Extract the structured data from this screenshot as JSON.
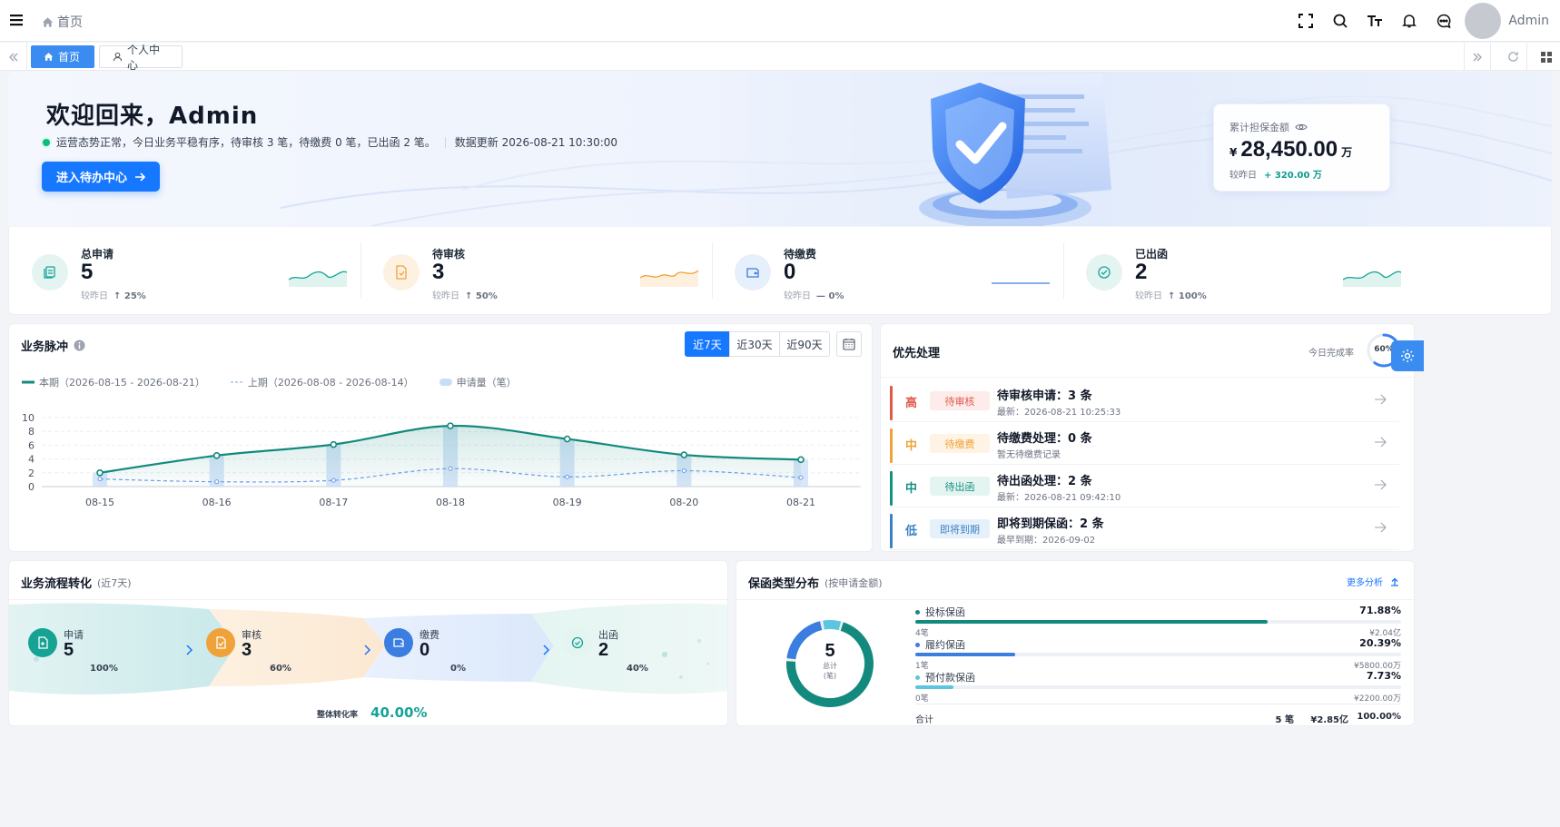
{
  "header": {
    "breadcrumb": "首页",
    "user_name": "Admin"
  },
  "tabs": [
    {
      "label": "首页",
      "active": true
    },
    {
      "label": "个人中心",
      "active": false
    }
  ],
  "hero": {
    "welcome": "欢迎回来，Admin",
    "status_text": "运营态势正常，今日业务平稳有序，待审核 3 笔，待缴费 0 笔，已出函 2 笔。",
    "data_update": "数据更新 2026-08-21 10:30:00",
    "cta_label": "进入待办中心"
  },
  "guarantee": {
    "label": "累计担保金额",
    "currency": "¥",
    "value": "28,450.00",
    "unit": "万",
    "compare_label": "较昨日",
    "compare_value": "+ 320.00 万"
  },
  "stats": [
    {
      "title": "总申请",
      "value": "5",
      "compare_label": "较昨日",
      "change": "↑ 25%",
      "color": "#14a39a"
    },
    {
      "title": "待审核",
      "value": "3",
      "compare_label": "较昨日",
      "change": "↑ 50%",
      "color": "#f0a23a"
    },
    {
      "title": "待缴费",
      "value": "0",
      "compare_label": "较昨日",
      "change": "— 0%",
      "color": "#3b7de0"
    },
    {
      "title": "已出函",
      "value": "2",
      "compare_label": "较昨日",
      "change": "↑ 100%",
      "color": "#14a39a"
    }
  ],
  "pulse": {
    "title": "业务脉冲",
    "ranges": [
      "近7天",
      "近30天",
      "近90天"
    ],
    "active_range": "近7天",
    "legend": {
      "current": "本期（2026-08-15 - 2026-08-21）",
      "previous": "上期（2026-08-08 - 2026-08-14）",
      "volume": "申请量（笔）"
    }
  },
  "chart_data": {
    "type": "line",
    "categories": [
      "08-15",
      "08-16",
      "08-17",
      "08-18",
      "08-19",
      "08-20",
      "08-21"
    ],
    "series": [
      {
        "name": "本期（2026-08-15 - 2026-08-21）",
        "type": "line",
        "values": [
          2,
          4.5,
          6.1,
          8.8,
          6.9,
          4.6,
          3.9
        ],
        "color": "#138a7c"
      },
      {
        "name": "上期（2026-08-08 - 2026-08-14）",
        "type": "line",
        "values": [
          1.1,
          0.7,
          0.9,
          2.6,
          1.4,
          2.3,
          1.3
        ],
        "color": "#6b9ee8",
        "dashed": true
      },
      {
        "name": "申请量（笔）",
        "type": "bar",
        "values": [
          2,
          4.5,
          6.1,
          8.8,
          6.9,
          4.6,
          3.9
        ],
        "color": "#c9def5"
      }
    ],
    "ylim": [
      0,
      10
    ],
    "yticks": [
      0,
      2,
      4,
      6,
      8,
      10
    ],
    "grid": true,
    "legend": "top-left"
  },
  "priority": {
    "title": "优先处理",
    "completion_label": "今日完成率",
    "completion_value": "60%",
    "completion_fraction": 0.6,
    "items": [
      {
        "level": "高",
        "tag": "待审核",
        "title": "待审核申请：3 条",
        "sub": "最新：2026-08-21 10:25:33",
        "color": "#e05a4c",
        "bg": "#fdecea"
      },
      {
        "level": "中",
        "tag": "待缴费",
        "title": "待缴费处理：0 条",
        "sub": "暂无待缴费记录",
        "color": "#f0a23a",
        "bg": "#fef3e4"
      },
      {
        "level": "中",
        "tag": "待出函",
        "title": "待出函处理：2 条",
        "sub": "最新：2026-08-21 09:42:10",
        "color": "#14917f",
        "bg": "#e3f4f1"
      },
      {
        "level": "低",
        "tag": "即将到期",
        "title": "即将到期保函：2 条",
        "sub": "最早到期：2026-09-02",
        "color": "#3b82c4",
        "bg": "#e6f0fa"
      }
    ]
  },
  "flow": {
    "title": "业务流程转化",
    "subtitle": "(近7天)",
    "steps": [
      {
        "label": "申请",
        "value": "5",
        "pct": "100%",
        "color": "#16a394"
      },
      {
        "label": "审核",
        "value": "3",
        "pct": "60%",
        "color": "#f0a23a"
      },
      {
        "label": "缴费",
        "value": "0",
        "pct": "0%",
        "color": "#3b7de0"
      },
      {
        "label": "出函",
        "value": "2",
        "pct": "40%",
        "color": "#16a394"
      }
    ],
    "overall_label": "整体转化率",
    "overall_value": "40.00%"
  },
  "distribution": {
    "title": "保函类型分布",
    "subtitle": "(按申请金额)",
    "more_label": "更多分析",
    "total_value": "5",
    "total_label": "总计",
    "total_unit": "(笔)",
    "items": [
      {
        "name": "投标保函",
        "pct": "71.88%",
        "fraction": 0.7188,
        "count": "4笔",
        "amount": "¥2.04亿",
        "color": "#148a7e"
      },
      {
        "name": "履约保函",
        "pct": "20.39%",
        "fraction": 0.2039,
        "count": "1笔",
        "amount": "¥5800.00万",
        "color": "#3b7de0"
      },
      {
        "name": "预付款保函",
        "pct": "7.73%",
        "fraction": 0.0773,
        "count": "0笔",
        "amount": "¥2200.00万",
        "color": "#5cc6e0"
      }
    ],
    "sum_label": "合计",
    "sum_count": "5 笔",
    "sum_amount": "¥2.85亿",
    "sum_pct": "100.00%"
  }
}
